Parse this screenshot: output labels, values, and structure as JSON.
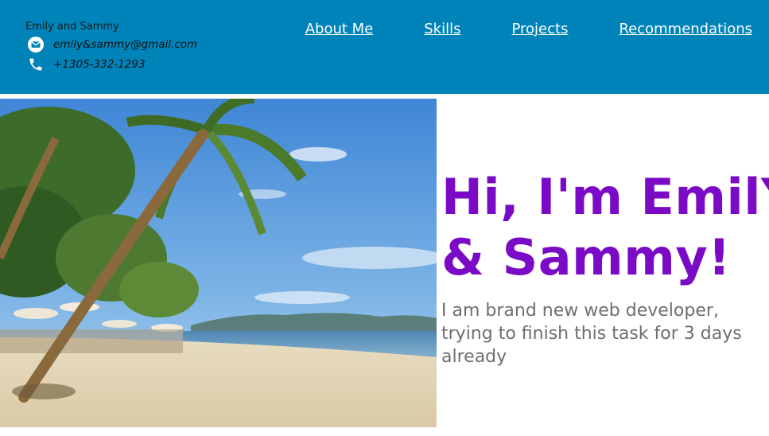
{
  "header": {
    "brand_name": "Emily and Sammy",
    "email": "emily&sammy@gmail.com",
    "phone": "+1305-332-1293",
    "background_color": "#0083b9"
  },
  "nav": {
    "items": [
      {
        "label": "About Me"
      },
      {
        "label": "Skills"
      },
      {
        "label": "Projects"
      },
      {
        "label": "Recommendations"
      }
    ]
  },
  "hero": {
    "title_line1": "Hi, I'm EmilY",
    "title_line2": "& Sammy!",
    "description": "I am brand new web developer, trying to finish this task for 3 days already",
    "title_color": "#7a0ac6",
    "text_color": "#6e6e6e",
    "image_subject": "tropical beach with palm trees"
  },
  "icons": {
    "email": "email-icon",
    "phone": "phone-icon"
  }
}
